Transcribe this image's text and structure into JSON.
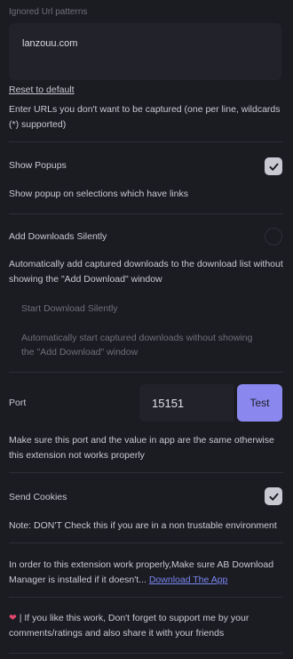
{
  "ignored": {
    "label": "Ignored Url patterns",
    "value": "lanzouu.com",
    "reset_label": "Reset to default",
    "help": "Enter URLs you don't want to be captured (one per line, wildcards (*) supported)"
  },
  "popups": {
    "label": "Show Popups",
    "checked": true,
    "help": "Show popup on selections which have links"
  },
  "silent": {
    "label": "Add Downloads Silently",
    "checked": false,
    "help": "Automatically add captured downloads to the download list without showing the \"Add Download\" window",
    "start_label": "Start Download Silently",
    "start_help": "Automatically start captured downloads without showing the \"Add Download\" window"
  },
  "port": {
    "label": "Port",
    "value": "15151",
    "test_label": "Test",
    "help": "Make sure this port and the value in app are the same otherwise this extension not works properly"
  },
  "cookies": {
    "label": "Send Cookies",
    "checked": true,
    "note": "Note: DON'T Check this if you are in a non trustable environment"
  },
  "install": {
    "text": "In order to this extension work properly,Make sure AB Download Manager is installed if it doesn't... ",
    "link": "Download The App"
  },
  "support": {
    "icon": "heart-icon",
    "text": " | If you like this work, Don't forget to support me by your comments/ratings and also share it with your friends"
  }
}
